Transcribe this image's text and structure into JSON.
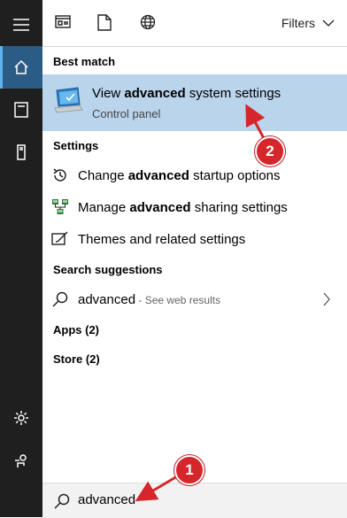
{
  "topbar": {
    "filters_label": "Filters"
  },
  "best_match": {
    "heading": "Best match",
    "title_pre": "View ",
    "title_bold": "advanced",
    "title_post": " system settings",
    "subtitle": "Control panel"
  },
  "settings": {
    "heading": "Settings",
    "items": [
      {
        "pre": "Change ",
        "bold": "advanced",
        "post": " startup options",
        "icon": "restart-icon"
      },
      {
        "pre": "Manage ",
        "bold": "advanced",
        "post": " sharing settings",
        "icon": "network-share-icon"
      },
      {
        "pre": "Themes and related settings",
        "bold": "",
        "post": "",
        "icon": "themes-icon"
      }
    ]
  },
  "suggestions": {
    "heading": "Search suggestions",
    "query": "advanced",
    "hint": " - See web results"
  },
  "apps": {
    "label": "Apps (2)"
  },
  "store": {
    "label": "Store (2)"
  },
  "search": {
    "value": "advanced"
  },
  "annotations": {
    "badge1": "1",
    "badge2": "2"
  },
  "colors": {
    "highlight": "#bad4ec",
    "rail": "#1f1f1f",
    "rail_active": "#2b5c86",
    "badge": "#d4262b"
  }
}
